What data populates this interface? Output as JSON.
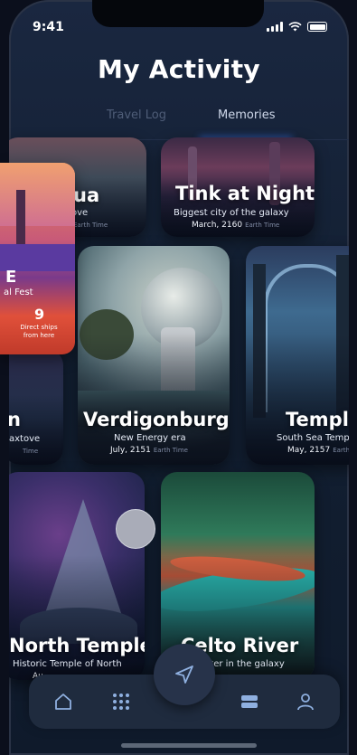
{
  "status_bar": {
    "time": "9:41"
  },
  "header": {
    "title": "My Activity"
  },
  "tabs": [
    {
      "label": "Travel Log",
      "active": false
    },
    {
      "label": "Memories",
      "active": true
    }
  ],
  "cards": {
    "aqua": {
      "title": "qua",
      "subtitle": "n Naxtove",
      "earth_time": "Earth Time"
    },
    "tink": {
      "title": "Tink at Night",
      "subtitle": "Biggest city of the galaxy",
      "date": "March, 2160",
      "earth_time": "Earth Time"
    },
    "n": {
      "title": "n",
      "subtitle": "axtove",
      "earth_time": "Time"
    },
    "verdigonburg": {
      "title": "Verdigonburg",
      "subtitle": "New Energy era",
      "date": "July, 2151",
      "earth_time": "Earth Time"
    },
    "temple": {
      "title": "Temple",
      "subtitle": "South Sea Temp",
      "date": "May, 2157",
      "earth_time": "Earth Tim"
    },
    "north_temple": {
      "title": "North Temple",
      "subtitle": "Historic Temple of North",
      "date": "Au"
    },
    "celto_river": {
      "title": "Celto River",
      "subtitle": "water in the galaxy"
    }
  },
  "floating_card": {
    "title": "E",
    "subtitle": "al Fest",
    "number": "9",
    "caption": "Direct ships from here"
  },
  "nav": {
    "items": [
      {
        "icon": "home-icon"
      },
      {
        "icon": "grid-icon"
      },
      {
        "icon": "send-icon"
      },
      {
        "icon": "stack-icon"
      },
      {
        "icon": "user-icon"
      }
    ]
  },
  "colors": {
    "background": "#0f1a2b",
    "accent": "#2d6fff",
    "nav_bg": "#1f2b3e"
  }
}
